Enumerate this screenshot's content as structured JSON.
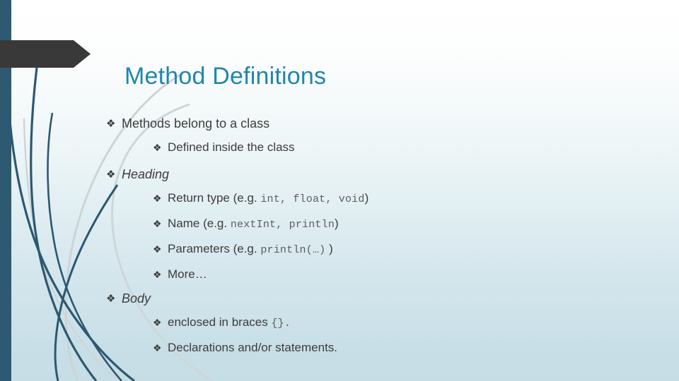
{
  "slide": {
    "title": "Method Definitions",
    "title_color": "#2086ab",
    "body_text_color": "#3d3d3d",
    "code_text_color": "#5d5d5d",
    "accent_bar_color": "#2d5a72",
    "banner_color": "#393939",
    "background_top_color": "#ffffff",
    "background_bottom_color": "#c7dde5",
    "bullet_glyph": "❖"
  },
  "content": {
    "items": [
      {
        "level": 1,
        "style": "normal",
        "text": "Methods belong to a class"
      },
      {
        "level": 2,
        "style": "normal",
        "text": "Defined inside the class"
      },
      {
        "level": 1,
        "style": "italic",
        "text": "Heading"
      },
      {
        "level": 2,
        "style": "normal",
        "text": "Return type (e.g.",
        "code": "int, float, void",
        "tail": ")"
      },
      {
        "level": 2,
        "style": "normal",
        "text": "Name (e.g.",
        "code": "nextInt, println",
        "tail": ")"
      },
      {
        "level": 2,
        "style": "normal",
        "text": "Parameters (e.g.",
        "code": "println(…)",
        "tail": " )"
      },
      {
        "level": 2,
        "style": "normal",
        "text": "More…"
      },
      {
        "level": 1,
        "style": "italic",
        "text": "Body"
      },
      {
        "level": 2,
        "style": "normal",
        "text": "enclosed in braces",
        "code": "{}.",
        "tail": ""
      },
      {
        "level": 2,
        "style": "normal",
        "text": "Declarations and/or statements."
      }
    ]
  },
  "decoration": {
    "left_bar_label": "left-accent-bar",
    "banner_label": "arrow-banner",
    "swoosh_dark_color": "#2c5871",
    "swoosh_light_color": "#c6cfd2"
  }
}
